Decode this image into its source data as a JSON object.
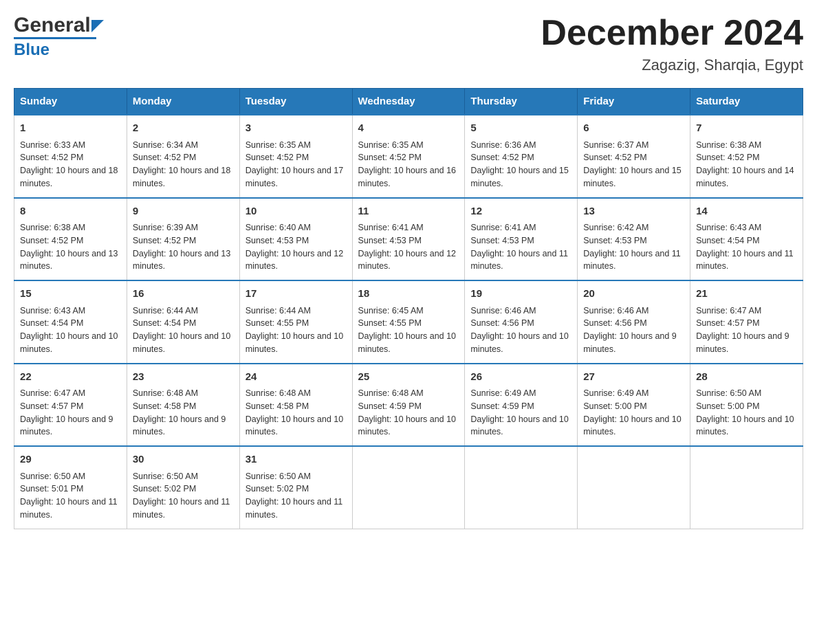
{
  "header": {
    "logo_general": "General",
    "logo_blue": "Blue",
    "month_title": "December 2024",
    "location": "Zagazig, Sharqia, Egypt"
  },
  "days_of_week": [
    "Sunday",
    "Monday",
    "Tuesday",
    "Wednesday",
    "Thursday",
    "Friday",
    "Saturday"
  ],
  "weeks": [
    [
      {
        "day": "1",
        "sunrise": "Sunrise: 6:33 AM",
        "sunset": "Sunset: 4:52 PM",
        "daylight": "Daylight: 10 hours and 18 minutes."
      },
      {
        "day": "2",
        "sunrise": "Sunrise: 6:34 AM",
        "sunset": "Sunset: 4:52 PM",
        "daylight": "Daylight: 10 hours and 18 minutes."
      },
      {
        "day": "3",
        "sunrise": "Sunrise: 6:35 AM",
        "sunset": "Sunset: 4:52 PM",
        "daylight": "Daylight: 10 hours and 17 minutes."
      },
      {
        "day": "4",
        "sunrise": "Sunrise: 6:35 AM",
        "sunset": "Sunset: 4:52 PM",
        "daylight": "Daylight: 10 hours and 16 minutes."
      },
      {
        "day": "5",
        "sunrise": "Sunrise: 6:36 AM",
        "sunset": "Sunset: 4:52 PM",
        "daylight": "Daylight: 10 hours and 15 minutes."
      },
      {
        "day": "6",
        "sunrise": "Sunrise: 6:37 AM",
        "sunset": "Sunset: 4:52 PM",
        "daylight": "Daylight: 10 hours and 15 minutes."
      },
      {
        "day": "7",
        "sunrise": "Sunrise: 6:38 AM",
        "sunset": "Sunset: 4:52 PM",
        "daylight": "Daylight: 10 hours and 14 minutes."
      }
    ],
    [
      {
        "day": "8",
        "sunrise": "Sunrise: 6:38 AM",
        "sunset": "Sunset: 4:52 PM",
        "daylight": "Daylight: 10 hours and 13 minutes."
      },
      {
        "day": "9",
        "sunrise": "Sunrise: 6:39 AM",
        "sunset": "Sunset: 4:52 PM",
        "daylight": "Daylight: 10 hours and 13 minutes."
      },
      {
        "day": "10",
        "sunrise": "Sunrise: 6:40 AM",
        "sunset": "Sunset: 4:53 PM",
        "daylight": "Daylight: 10 hours and 12 minutes."
      },
      {
        "day": "11",
        "sunrise": "Sunrise: 6:41 AM",
        "sunset": "Sunset: 4:53 PM",
        "daylight": "Daylight: 10 hours and 12 minutes."
      },
      {
        "day": "12",
        "sunrise": "Sunrise: 6:41 AM",
        "sunset": "Sunset: 4:53 PM",
        "daylight": "Daylight: 10 hours and 11 minutes."
      },
      {
        "day": "13",
        "sunrise": "Sunrise: 6:42 AM",
        "sunset": "Sunset: 4:53 PM",
        "daylight": "Daylight: 10 hours and 11 minutes."
      },
      {
        "day": "14",
        "sunrise": "Sunrise: 6:43 AM",
        "sunset": "Sunset: 4:54 PM",
        "daylight": "Daylight: 10 hours and 11 minutes."
      }
    ],
    [
      {
        "day": "15",
        "sunrise": "Sunrise: 6:43 AM",
        "sunset": "Sunset: 4:54 PM",
        "daylight": "Daylight: 10 hours and 10 minutes."
      },
      {
        "day": "16",
        "sunrise": "Sunrise: 6:44 AM",
        "sunset": "Sunset: 4:54 PM",
        "daylight": "Daylight: 10 hours and 10 minutes."
      },
      {
        "day": "17",
        "sunrise": "Sunrise: 6:44 AM",
        "sunset": "Sunset: 4:55 PM",
        "daylight": "Daylight: 10 hours and 10 minutes."
      },
      {
        "day": "18",
        "sunrise": "Sunrise: 6:45 AM",
        "sunset": "Sunset: 4:55 PM",
        "daylight": "Daylight: 10 hours and 10 minutes."
      },
      {
        "day": "19",
        "sunrise": "Sunrise: 6:46 AM",
        "sunset": "Sunset: 4:56 PM",
        "daylight": "Daylight: 10 hours and 10 minutes."
      },
      {
        "day": "20",
        "sunrise": "Sunrise: 6:46 AM",
        "sunset": "Sunset: 4:56 PM",
        "daylight": "Daylight: 10 hours and 9 minutes."
      },
      {
        "day": "21",
        "sunrise": "Sunrise: 6:47 AM",
        "sunset": "Sunset: 4:57 PM",
        "daylight": "Daylight: 10 hours and 9 minutes."
      }
    ],
    [
      {
        "day": "22",
        "sunrise": "Sunrise: 6:47 AM",
        "sunset": "Sunset: 4:57 PM",
        "daylight": "Daylight: 10 hours and 9 minutes."
      },
      {
        "day": "23",
        "sunrise": "Sunrise: 6:48 AM",
        "sunset": "Sunset: 4:58 PM",
        "daylight": "Daylight: 10 hours and 9 minutes."
      },
      {
        "day": "24",
        "sunrise": "Sunrise: 6:48 AM",
        "sunset": "Sunset: 4:58 PM",
        "daylight": "Daylight: 10 hours and 10 minutes."
      },
      {
        "day": "25",
        "sunrise": "Sunrise: 6:48 AM",
        "sunset": "Sunset: 4:59 PM",
        "daylight": "Daylight: 10 hours and 10 minutes."
      },
      {
        "day": "26",
        "sunrise": "Sunrise: 6:49 AM",
        "sunset": "Sunset: 4:59 PM",
        "daylight": "Daylight: 10 hours and 10 minutes."
      },
      {
        "day": "27",
        "sunrise": "Sunrise: 6:49 AM",
        "sunset": "Sunset: 5:00 PM",
        "daylight": "Daylight: 10 hours and 10 minutes."
      },
      {
        "day": "28",
        "sunrise": "Sunrise: 6:50 AM",
        "sunset": "Sunset: 5:00 PM",
        "daylight": "Daylight: 10 hours and 10 minutes."
      }
    ],
    [
      {
        "day": "29",
        "sunrise": "Sunrise: 6:50 AM",
        "sunset": "Sunset: 5:01 PM",
        "daylight": "Daylight: 10 hours and 11 minutes."
      },
      {
        "day": "30",
        "sunrise": "Sunrise: 6:50 AM",
        "sunset": "Sunset: 5:02 PM",
        "daylight": "Daylight: 10 hours and 11 minutes."
      },
      {
        "day": "31",
        "sunrise": "Sunrise: 6:50 AM",
        "sunset": "Sunset: 5:02 PM",
        "daylight": "Daylight: 10 hours and 11 minutes."
      },
      null,
      null,
      null,
      null
    ]
  ]
}
